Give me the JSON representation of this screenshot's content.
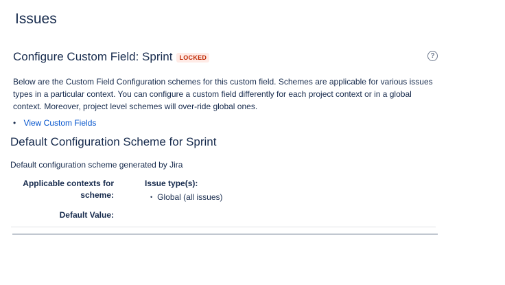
{
  "page": {
    "title": "Issues"
  },
  "header": {
    "title": "Configure Custom Field: Sprint",
    "lozenge": "LOCKED",
    "help_icon": "?"
  },
  "description": "Below are the Custom Field Configuration schemes for this custom field. Schemes are applicable for various issues types in a particular context. You can configure a custom field differently for each project context or in a global context. Moreover, project level schemes will over-ride global ones.",
  "links": [
    {
      "label": "View Custom Fields"
    }
  ],
  "scheme": {
    "title": "Default Configuration Scheme for Sprint",
    "description": "Default configuration scheme generated by Jira",
    "contexts_label_line1": "Applicable contexts for",
    "contexts_label_line2": "scheme:",
    "issue_types_heading": "Issue type(s):",
    "issue_types": [
      "Global (all issues)"
    ],
    "default_value_label": "Default Value:"
  },
  "colors": {
    "link": "#0052cc",
    "text": "#172b4d",
    "lozenge_bg": "#ffebe6",
    "lozenge_text": "#bf2600"
  },
  "icons": [
    "help-icon"
  ]
}
